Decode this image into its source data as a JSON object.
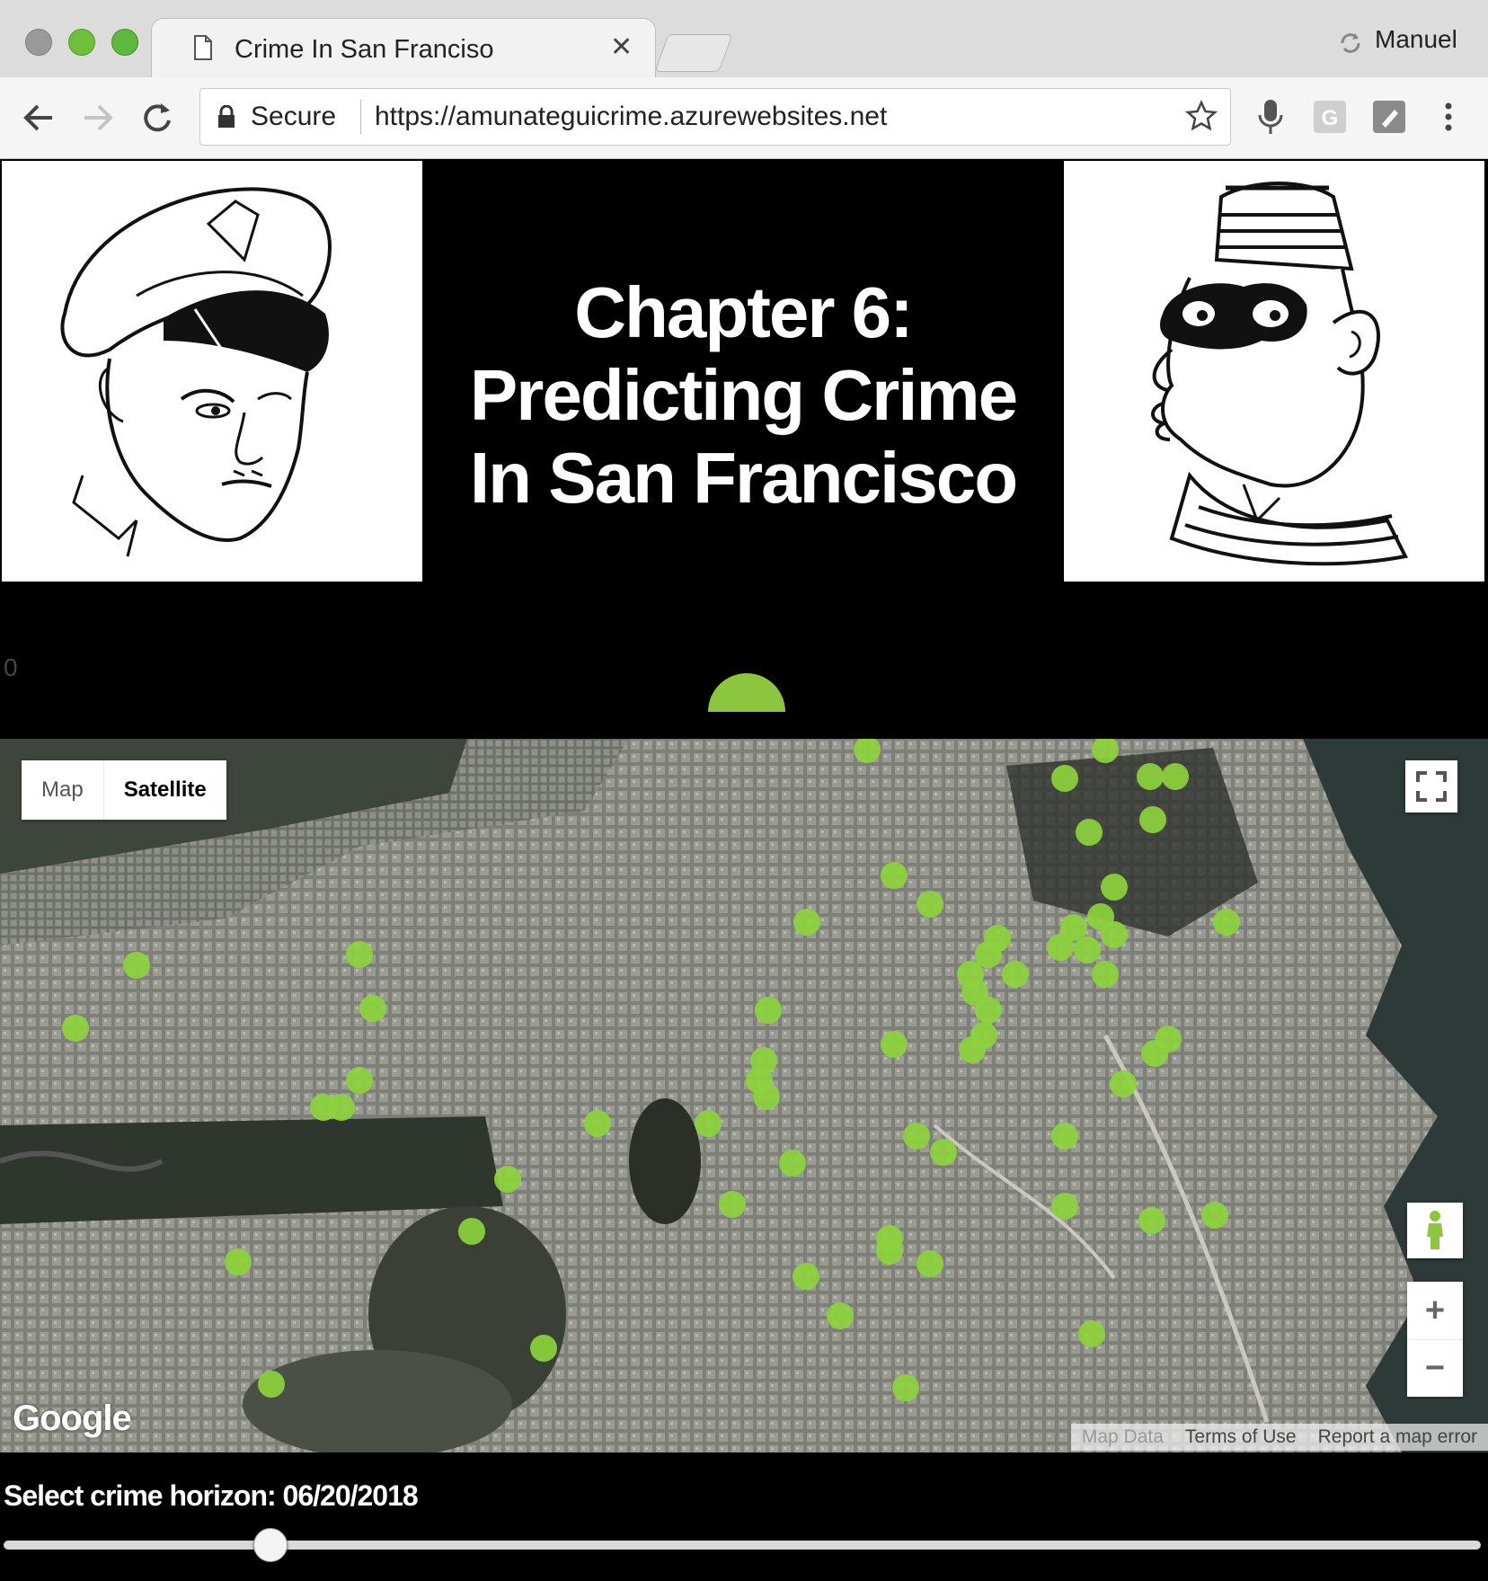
{
  "window": {
    "tab_title": "Crime In San Franciso",
    "profile_name": "Manuel"
  },
  "omnibox": {
    "secure_label": "Secure",
    "url": "https://amunateguicrime.azurewebsites.net"
  },
  "header": {
    "title_lines": [
      "Chapter 6:",
      "Predicting Crime",
      "In San Francisco"
    ]
  },
  "gauge": {
    "min_label": "0",
    "color": "#8cc63f"
  },
  "map": {
    "type_buttons": [
      "Map",
      "Satellite"
    ],
    "selected_type": "Satellite",
    "attribution": [
      "Map Data",
      "Terms of Use",
      "Report a map error"
    ],
    "logo_text": "Google",
    "marker_color": "#8cd23c"
  },
  "slider": {
    "label": "Select crime horizon: 06/20/2018",
    "value_fraction": 0.18
  }
}
